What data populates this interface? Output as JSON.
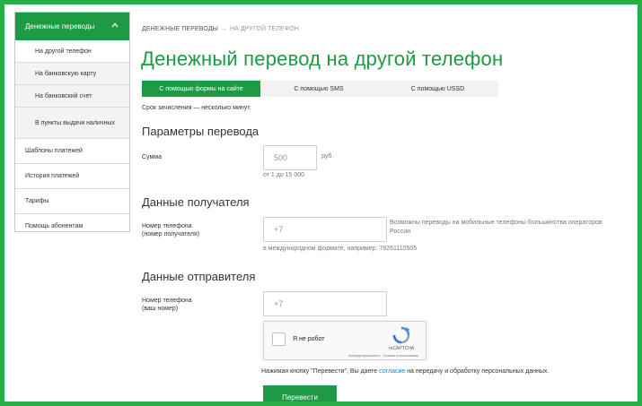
{
  "sidebar": {
    "header": "Денежные переводы",
    "subitems": [
      {
        "label": "На другой телефон"
      },
      {
        "label": "На банковскую карту"
      },
      {
        "label": "На банковский счет"
      },
      {
        "label": "В пункты выдачи наличных"
      }
    ],
    "items": [
      {
        "label": "Шаблоны платежей"
      },
      {
        "label": "История платежей"
      },
      {
        "label": "Тарифы"
      },
      {
        "label": "Помощь абонентам"
      }
    ]
  },
  "breadcrumb": {
    "parent": "ДЕНЕЖНЫЕ ПЕРЕВОДЫ",
    "separator": "→",
    "current": "НА ДРУГОЙ ТЕЛЕФОН"
  },
  "page_title": "Денежный перевод на другой телефон",
  "tabs": [
    {
      "label": "С помощью формы на сайте",
      "active": true
    },
    {
      "label": "С помощью SMS",
      "active": false
    },
    {
      "label": "С помощью USSD",
      "active": false
    }
  ],
  "note": "Срок зачисления — несколько минут.",
  "params": {
    "title": "Параметры перевода",
    "amount_label": "Сумма",
    "amount_placeholder": "500",
    "amount_unit": "руб.",
    "amount_hint": "от 1 до 15 000"
  },
  "recipient": {
    "title": "Данные получателя",
    "phone_label_line1": "Номер телефона",
    "phone_label_line2": "(номер получателя)",
    "phone_placeholder": "+7",
    "side_hint": "Возможны переводы на мобильные телефоны большинства операторов России",
    "format_hint": "в международном формате, например: 79261110505"
  },
  "sender": {
    "title": "Данные отправителя",
    "phone_label_line1": "Номер телефона",
    "phone_label_line2": "(ваш номер)",
    "phone_placeholder": "+7"
  },
  "captcha": {
    "label": "Я не робот",
    "brand": "reCAPTCHA",
    "links": "Конфиденциальность · Условия использования"
  },
  "consent": {
    "before": "Нажимая кнопку \"Перевести\", Вы даете ",
    "link": "согласие",
    "after": " на передачу и обработку персональных данных."
  },
  "submit_label": "Перевести",
  "colors": {
    "brand": "#1d9a43",
    "frame": "#27ae47",
    "link": "#1d7fbf"
  }
}
